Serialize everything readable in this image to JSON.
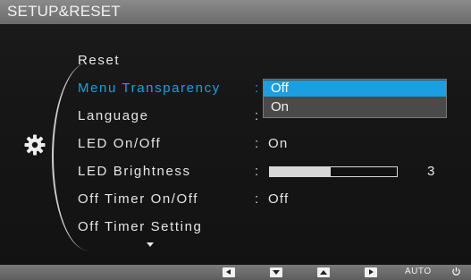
{
  "title": "SETUP&RESET",
  "menu": {
    "items": [
      {
        "label": "Reset",
        "value": ""
      },
      {
        "label": "Menu Transparency",
        "value": ""
      },
      {
        "label": "Language",
        "value": ""
      },
      {
        "label": "LED On/Off",
        "value": "On"
      },
      {
        "label": "LED Brightness",
        "value": "3"
      },
      {
        "label": "Off Timer On/Off",
        "value": "Off"
      },
      {
        "label": "Off Timer Setting",
        "value": ""
      }
    ],
    "selected_index": 1,
    "colon": ":"
  },
  "dropdown": {
    "options": [
      "Off",
      "On"
    ],
    "selected": "Off"
  },
  "led_brightness": {
    "value": 3,
    "fill_fraction": 0.48
  },
  "buttons": {
    "auto_label": "AUTO",
    "left_icon": "left-arrow-icon",
    "down_icon": "down-arrow-icon",
    "up_icon": "up-arrow-icon",
    "enter_icon": "enter-icon",
    "power_icon": "power-icon"
  },
  "colors": {
    "accent": "#1aa0e0",
    "text": "#e6e6e6",
    "bar": "#7a7a7a"
  }
}
